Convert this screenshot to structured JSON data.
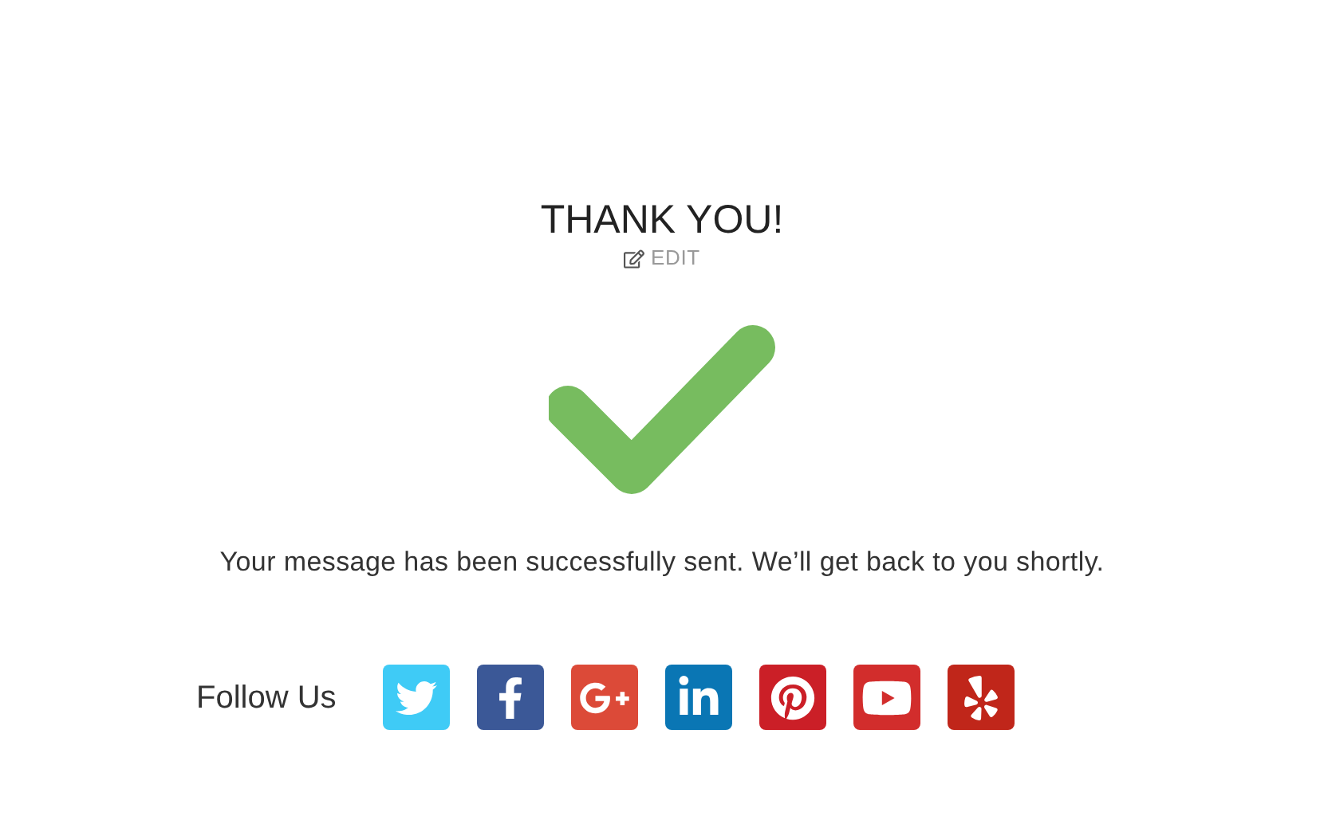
{
  "title": "THANK YOU!",
  "edit_link": "EDIT",
  "message": "Your message has been successfully sent. We’ll get back to you shortly.",
  "follow": {
    "label": "Follow Us",
    "links": [
      {
        "kind": "twitter",
        "color": "#3fcbf6"
      },
      {
        "kind": "facebook",
        "color": "#3b5897"
      },
      {
        "kind": "googleplus",
        "color": "#dc4a38"
      },
      {
        "kind": "linkedin",
        "color": "#0a76b4"
      },
      {
        "kind": "pinterest",
        "color": "#cb1f27"
      },
      {
        "kind": "youtube",
        "color": "#d22d2c"
      },
      {
        "kind": "yelp",
        "color": "#c0261a"
      }
    ]
  }
}
